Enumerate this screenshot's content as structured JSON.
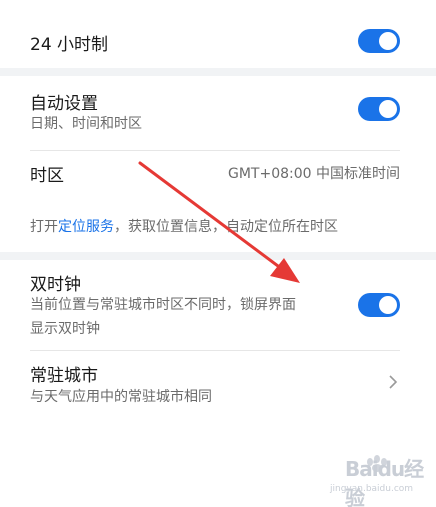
{
  "settings": {
    "clock24": {
      "label": "24 小时制",
      "enabled": true
    },
    "auto_set": {
      "label": "自动设置",
      "sub": "日期、时间和时区",
      "enabled": true
    },
    "timezone": {
      "label": "时区",
      "value": "GMT+08:00 中国标准时间"
    },
    "location_note": {
      "prefix": "打开",
      "link": "定位服务",
      "suffix": "，获取位置信息，自动定位所在时区"
    },
    "dual_clock": {
      "label": "双时钟",
      "sub_line1": "当前位置与常驻城市时区不同时，锁屏界面",
      "sub_line2": "显示双时钟",
      "enabled": true
    },
    "home_city": {
      "label": "常驻城市",
      "sub": "与天气应用中的常驻城市相同"
    }
  },
  "watermark": {
    "text": "Baidu经验",
    "url": "jingyan.baidu.com"
  },
  "colors": {
    "accent": "#1a73e8",
    "arrow": "#e53935",
    "section_gap": "#f1f3f5"
  },
  "icons": {
    "chevron": "chevron-right-icon"
  }
}
